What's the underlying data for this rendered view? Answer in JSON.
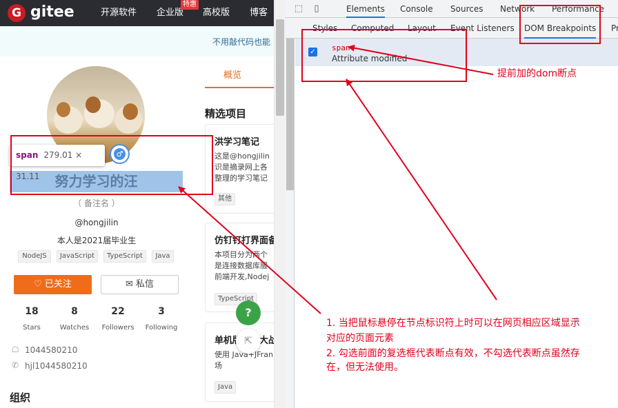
{
  "gitee": {
    "logo_letter": "G",
    "logo": "gitee",
    "nav": [
      "开源软件",
      "企业版",
      "高校版",
      "博客"
    ],
    "nav_badge": "特惠",
    "banner_text": "不用敲代码也能",
    "tooltip": {
      "tag": "span",
      "dims": "279.01 × 31.11"
    },
    "profile": {
      "name": "努力学习的汪",
      "note": "（ 备注名 ）",
      "handle": "@hongjilin",
      "bio": "本人是2021届毕业生",
      "tags": [
        "NodeJS",
        "JavaScript",
        "TypeScript",
        "Java"
      ],
      "follow_label": "已关注",
      "message_label": "私信",
      "stats": [
        {
          "value": "18",
          "label": "Stars"
        },
        {
          "value": "8",
          "label": "Watches"
        },
        {
          "value": "22",
          "label": "Followers"
        },
        {
          "value": "3",
          "label": "Following"
        }
      ],
      "qq": "1044580210",
      "wechat": "hjl1044580210",
      "org_heading": "组织"
    },
    "overview_tab": "概览",
    "featured_heading": "精选项目",
    "cards": [
      {
        "title": "洪学习笔记",
        "desc": [
          "这是@hongjilin",
          "识是摘录网上各",
          "整理的学习笔记"
        ],
        "tag": "其他"
      },
      {
        "title": "仿钉钉打界面备",
        "desc": [
          "本项目分为两个",
          "是连接数据库服",
          "前端开发,Nodej"
        ],
        "tag": "TypeScript"
      },
      {
        "title": "单机版坦克大战",
        "desc": [
          "使用 Java+JFran",
          "场"
        ],
        "tag": "Java"
      }
    ],
    "help_label": "?"
  },
  "devtools": {
    "tabs": [
      "Elements",
      "Console",
      "Sources",
      "Network",
      "Performance"
    ],
    "subtabs": [
      "Styles",
      "Computed",
      "Layout",
      "Event Listeners",
      "DOM Breakpoints",
      "Pr"
    ],
    "breakpoint": {
      "checked": true,
      "node": "span",
      "type": "Attribute modified"
    }
  },
  "annotations": {
    "label_breakpoint": "提前加的dom断点",
    "notes": [
      "1. 当把鼠标悬停在节点标识符上时可以在网页相应区域显示",
      "对应的页面元素",
      "2. 勾选前面的复选框代表断点有效，不勾选代表断点虽然存",
      "在，但无法使用。"
    ]
  }
}
